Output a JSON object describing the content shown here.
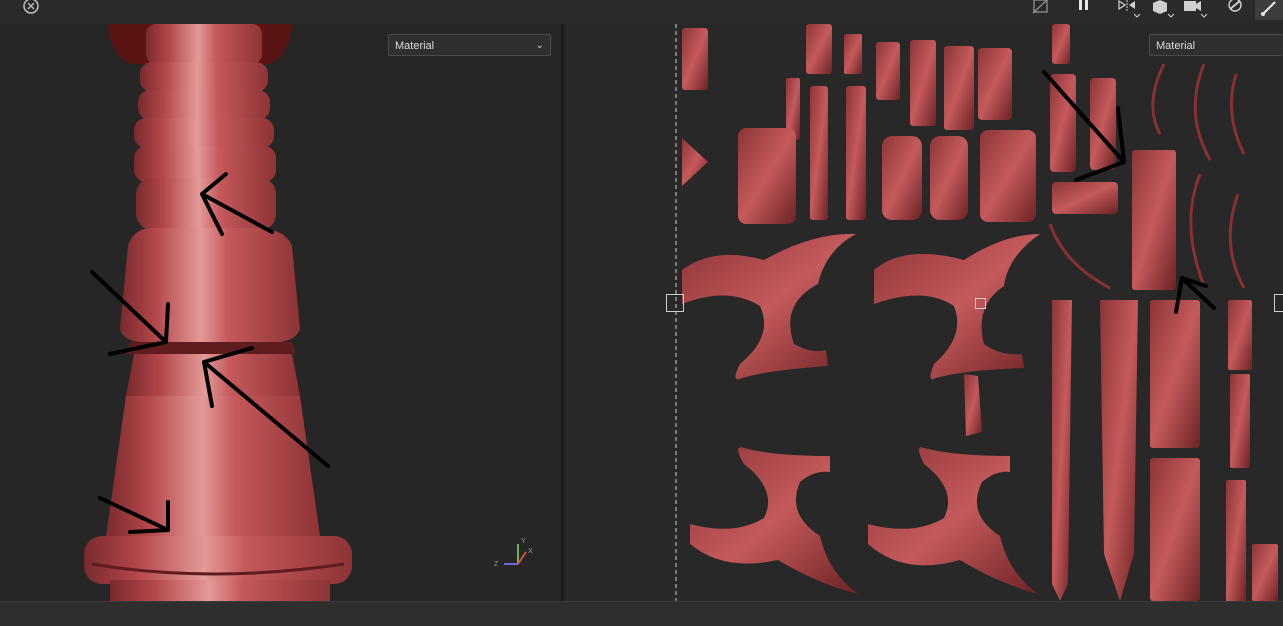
{
  "toolbar": {
    "left_icon": "reset-camera-icon",
    "right_icons": [
      "hide-unwrap-icon",
      "pause-icon",
      "flip-view-icon",
      "cube-display-icon",
      "camera-icon",
      "lighting-icon",
      "brush-icon"
    ]
  },
  "viewport3d": {
    "channel_dropdown": "Material",
    "axis_labels": {
      "x": "X",
      "y": "Y",
      "z": "Z"
    }
  },
  "viewportUV": {
    "channel_dropdown": "Material"
  },
  "colors": {
    "accent_red": "#b94a4e",
    "background": "#262626",
    "annotation": "#000000"
  }
}
